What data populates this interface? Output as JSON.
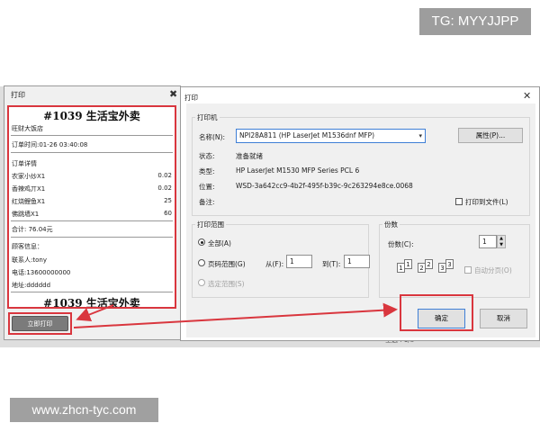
{
  "watermark_top": "TG: MYYJJPP",
  "watermark_bottom": "www.zhcn-tyc.com",
  "background": {
    "footer_text": "全选 : 1/8"
  },
  "receipt_dialog": {
    "title": "打印",
    "close_icon": "close-icon",
    "order_heading": "#1039 生活宝外卖",
    "shop": "旺财大饭店",
    "order_time": "订单时间:01-26 03:40:08",
    "details_label": "订单详情",
    "items": [
      {
        "name": "农家小炒X1",
        "price": "0.02"
      },
      {
        "name": "香辣鸡丌X1",
        "price": "0.02"
      },
      {
        "name": "红烧鲤鱼X1",
        "price": "25"
      },
      {
        "name": "佛跳墙X1",
        "price": "60"
      }
    ],
    "total": "合计: 76.04元",
    "customer_label": "顾客信息：",
    "contact": "联系人:tony",
    "phone": "电话:13600000000",
    "address": "地址:dddddd",
    "order_heading_repeat": "#1039 生活宝外卖",
    "print_now_label": "立即打印"
  },
  "print_dialog": {
    "title": "打印",
    "close_icon": "close-icon",
    "printer_group": "打印机",
    "name_label": "名称(N):",
    "printer_name": "NPI28A811 (HP LaserJet M1536dnf MFP)",
    "properties_label": "属性(P)...",
    "status_label": "状态:",
    "status_value": "准备就绪",
    "type_label": "类型:",
    "type_value": "HP LaserJet M1530 MFP Series PCL 6",
    "where_label": "位置:",
    "where_value": "WSD-3a642cc9-4b2f-495f-b39c-9c263294e8ce.0068",
    "comment_label": "备注:",
    "print_to_file": "打印到文件(L)",
    "range_group": "打印范围",
    "all_label": "全部(A)",
    "pages_label": "页码范围(G)",
    "from_label": "从(F):",
    "from_value": "1",
    "to_label": "到(T):",
    "to_value": "1",
    "selection_label": "选定范围(S)",
    "copies_group": "份数",
    "copies_label": "份数(C):",
    "copies_value": "1",
    "collate_label": "自动分页(O)",
    "collate_pages": [
      "1",
      "1",
      "2",
      "2",
      "3",
      "3"
    ],
    "ok_label": "确定",
    "cancel_label": "取消"
  },
  "colors": {
    "highlight": "#d9363e",
    "accent": "#3f7fd6"
  }
}
